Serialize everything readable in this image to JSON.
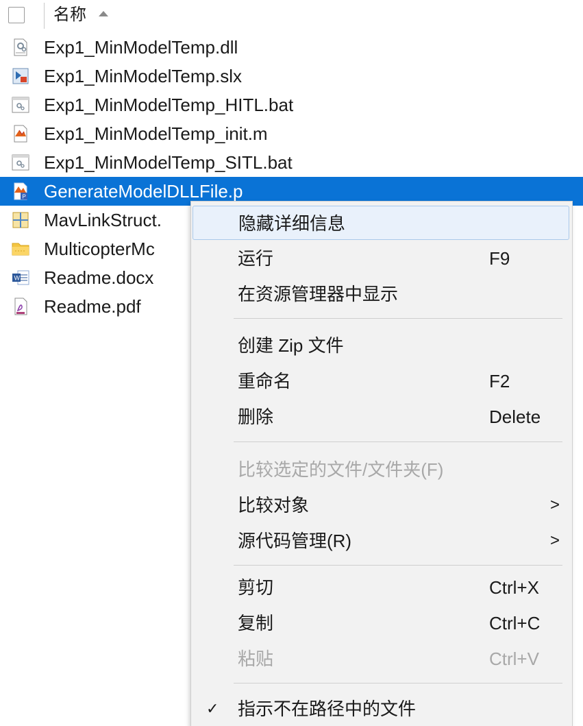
{
  "header": {
    "column_name": "名称"
  },
  "files": [
    {
      "name": "Exp1_MinModelTemp.dll",
      "icon": "dll-file-icon"
    },
    {
      "name": "Exp1_MinModelTemp.slx",
      "icon": "simulink-model-icon"
    },
    {
      "name": "Exp1_MinModelTemp_HITL.bat",
      "icon": "bat-file-icon"
    },
    {
      "name": "Exp1_MinModelTemp_init.m",
      "icon": "matlab-script-icon"
    },
    {
      "name": "Exp1_MinModelTemp_SITL.bat",
      "icon": "bat-file-icon"
    },
    {
      "name": "GenerateModelDLLFile.p",
      "icon": "matlab-p-file-icon",
      "selected": true
    },
    {
      "name": "MavLinkStruct.",
      "icon": "mat-file-icon"
    },
    {
      "name": "MulticopterMc",
      "icon": "folder-icon"
    },
    {
      "name": "Readme.docx",
      "icon": "word-doc-icon"
    },
    {
      "name": "Readme.pdf",
      "icon": "pdf-file-icon"
    }
  ],
  "context_menu": {
    "hide_details": "隐藏详细信息",
    "run": "运行",
    "run_shortcut": "F9",
    "show_in_explorer": "在资源管理器中显示",
    "create_zip": "创建 Zip 文件",
    "rename": "重命名",
    "rename_shortcut": "F2",
    "delete": "删除",
    "delete_shortcut": "Delete",
    "compare_selected": "比较选定的文件/文件夹(F)",
    "compare_against": "比较对象",
    "source_control": "源代码管理(R)",
    "submenu_arrow": ">",
    "cut": "剪切",
    "cut_shortcut": "Ctrl+X",
    "copy": "复制",
    "copy_shortcut": "Ctrl+C",
    "paste": "粘贴",
    "paste_shortcut": "Ctrl+V",
    "indicate_not_on_path": "指示不在路径中的文件",
    "check_mark": "✓"
  },
  "colors": {
    "selection": "#0a73d6",
    "menu_bg": "#f2f2f2",
    "hover": "#e9f1fb",
    "disabled": "#a8a8a8"
  }
}
